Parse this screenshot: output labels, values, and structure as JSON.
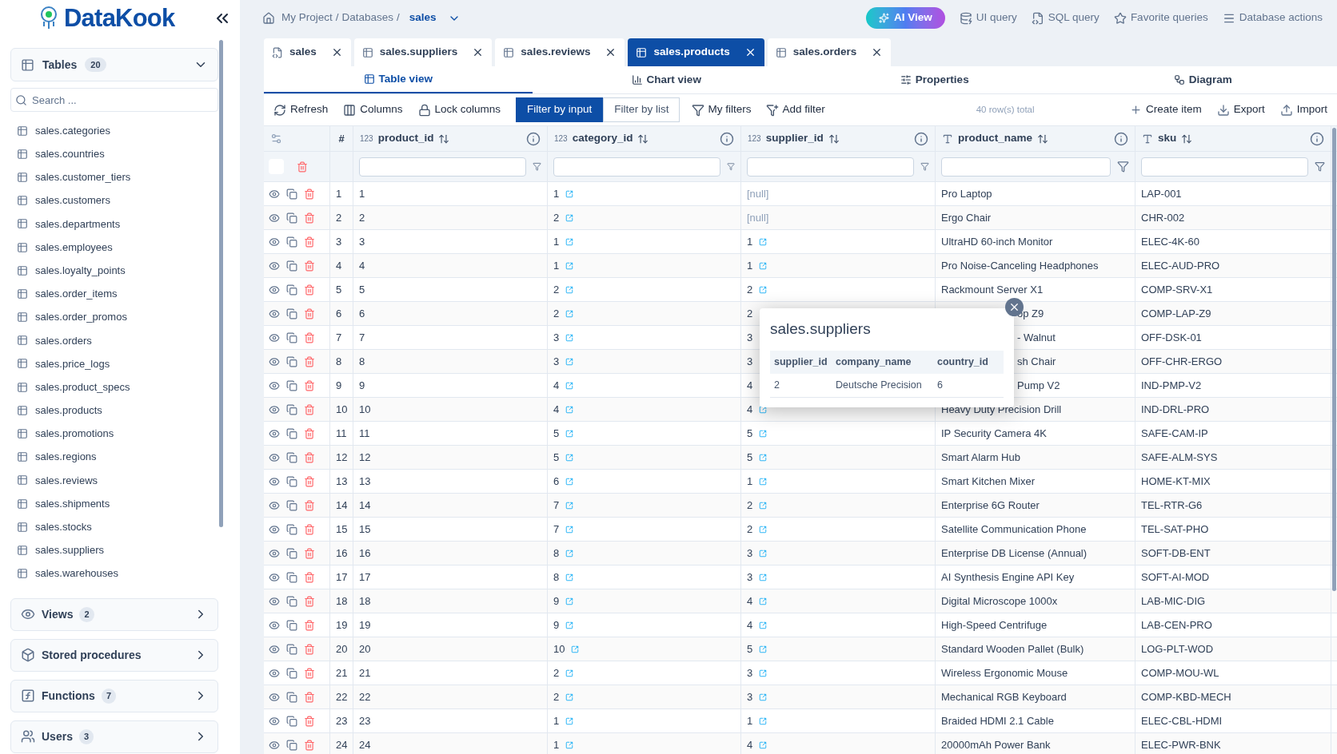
{
  "sidebar": {
    "logo": "DataKook",
    "tables": {
      "label": "Tables",
      "count": "20",
      "expanded": true,
      "search_placeholder": "Search ...",
      "items": [
        "sales.categories",
        "sales.countries",
        "sales.customer_tiers",
        "sales.customers",
        "sales.departments",
        "sales.employees",
        "sales.loyalty_points",
        "sales.order_items",
        "sales.order_promos",
        "sales.orders",
        "sales.price_logs",
        "sales.product_specs",
        "sales.products",
        "sales.promotions",
        "sales.regions",
        "sales.reviews",
        "sales.shipments",
        "sales.stocks",
        "sales.suppliers",
        "sales.warehouses"
      ]
    },
    "sections": [
      {
        "label": "Views",
        "count": "2",
        "kind": "views",
        "expanded": false
      },
      {
        "label": "Stored procedures",
        "kind": "procedures",
        "expanded": false
      },
      {
        "label": "Functions",
        "count": "7",
        "kind": "functions",
        "expanded": false
      },
      {
        "label": "Users",
        "count": "3",
        "kind": "users",
        "expanded": false
      }
    ]
  },
  "breadcrumb": {
    "items": [
      "My Project",
      "Databases"
    ],
    "separator": "/",
    "current": "sales"
  },
  "top_actions": {
    "ai": "AI View",
    "items": [
      {
        "label": "UI query",
        "kind": "ui"
      },
      {
        "label": "SQL query",
        "kind": "sql"
      },
      {
        "label": "Favorite queries",
        "kind": "favorite"
      },
      {
        "label": "Database actions",
        "kind": "menu"
      }
    ]
  },
  "tabs": [
    {
      "label": "sales",
      "kind": "sql",
      "selected": false
    },
    {
      "label": "sales.suppliers",
      "kind": "table",
      "selected": false
    },
    {
      "label": "sales.reviews",
      "kind": "table",
      "selected": false
    },
    {
      "label": "sales.products",
      "kind": "table",
      "selected": true
    },
    {
      "label": "sales.orders",
      "kind": "table",
      "selected": false
    }
  ],
  "view_tabs": [
    {
      "label": "Table view",
      "kind": "table",
      "selected": true
    },
    {
      "label": "Chart view",
      "kind": "chart",
      "selected": false
    },
    {
      "label": "Properties",
      "kind": "properties",
      "selected": false
    },
    {
      "label": "Diagram",
      "kind": "diagram",
      "selected": false
    }
  ],
  "toolbar": {
    "left": [
      {
        "label": "Refresh",
        "kind": "refresh"
      },
      {
        "label": "Columns",
        "kind": "columns"
      },
      {
        "label": "Lock columns",
        "kind": "lock"
      }
    ],
    "filter_modes": [
      {
        "label": "Filter by input",
        "selected": true
      },
      {
        "label": "Filter by list",
        "selected": false
      }
    ],
    "filters": [
      {
        "label": "My filters",
        "kind": "my"
      },
      {
        "label": "Add filter",
        "kind": "add"
      }
    ],
    "row_count": "40 row(s) total",
    "right": [
      {
        "label": "Create item",
        "kind": "create"
      },
      {
        "label": "Export",
        "kind": "export"
      },
      {
        "label": "Import",
        "kind": "import"
      }
    ]
  },
  "table": {
    "number_header": "#",
    "select_all": {
      "checked": false
    },
    "columns": [
      {
        "name": "product_id",
        "kind": "number",
        "type_label": "123"
      },
      {
        "name": "category_id",
        "kind": "number",
        "type_label": "123"
      },
      {
        "name": "supplier_id",
        "kind": "number",
        "type_label": "123"
      },
      {
        "name": "product_name",
        "kind": "text"
      },
      {
        "name": "sku",
        "kind": "text"
      }
    ],
    "rows": [
      {
        "number": "1",
        "cells": [
          "1",
          {
            "text": "1",
            "kind": "link"
          },
          {
            "text": "[null]",
            "kind": "null"
          },
          "Pro Laptop",
          "LAP-001"
        ]
      },
      {
        "number": "2",
        "cells": [
          "2",
          {
            "text": "2",
            "kind": "link"
          },
          {
            "text": "[null]",
            "kind": "null"
          },
          "Ergo Chair",
          "CHR-002"
        ]
      },
      {
        "number": "3",
        "cells": [
          "3",
          {
            "text": "1",
            "kind": "link"
          },
          {
            "text": "1",
            "kind": "link"
          },
          "UltraHD 60-inch Monitor",
          "ELEC-4K-60"
        ]
      },
      {
        "number": "4",
        "cells": [
          "4",
          {
            "text": "1",
            "kind": "link"
          },
          {
            "text": "1",
            "kind": "link"
          },
          "Pro Noise-Canceling Headphones",
          "ELEC-AUD-PRO"
        ]
      },
      {
        "number": "5",
        "cells": [
          "5",
          {
            "text": "2",
            "kind": "link"
          },
          {
            "text": "2",
            "kind": "link"
          },
          "Rackmount Server X1",
          "COMP-SRV-X1"
        ]
      },
      {
        "number": "6",
        "cells": [
          "6",
          {
            "text": "2",
            "kind": "link"
          },
          {
            "text": "2",
            "kind": "covered"
          },
          {
            "text": "op Z9",
            "kind": "partial"
          },
          "COMP-LAP-Z9"
        ]
      },
      {
        "number": "7",
        "cells": [
          "7",
          {
            "text": "3",
            "kind": "link"
          },
          {
            "text": "3",
            "kind": "covered"
          },
          {
            "text": "- Walnut",
            "kind": "partial"
          },
          "OFF-DSK-01"
        ]
      },
      {
        "number": "8",
        "cells": [
          "8",
          {
            "text": "3",
            "kind": "link"
          },
          {
            "text": "3",
            "kind": "covered"
          },
          {
            "text": "sh Chair",
            "kind": "partial"
          },
          "OFF-CHR-ERGO"
        ]
      },
      {
        "number": "9",
        "cells": [
          "9",
          {
            "text": "4",
            "kind": "link"
          },
          {
            "text": "4",
            "kind": "covered"
          },
          {
            "text": "Pump V2",
            "kind": "partial"
          },
          "IND-PMP-V2"
        ]
      },
      {
        "number": "10",
        "cells": [
          "10",
          {
            "text": "4",
            "kind": "link"
          },
          {
            "text": "4",
            "kind": "link"
          },
          "Heavy Duty Precision Drill",
          "IND-DRL-PRO"
        ]
      },
      {
        "number": "11",
        "cells": [
          "11",
          {
            "text": "5",
            "kind": "link"
          },
          {
            "text": "5",
            "kind": "link"
          },
          "IP Security Camera 4K",
          "SAFE-CAM-IP"
        ]
      },
      {
        "number": "12",
        "cells": [
          "12",
          {
            "text": "5",
            "kind": "link"
          },
          {
            "text": "5",
            "kind": "link"
          },
          "Smart Alarm Hub",
          "SAFE-ALM-SYS"
        ]
      },
      {
        "number": "13",
        "cells": [
          "13",
          {
            "text": "6",
            "kind": "link"
          },
          {
            "text": "1",
            "kind": "link"
          },
          "Smart Kitchen Mixer",
          "HOME-KT-MIX"
        ]
      },
      {
        "number": "14",
        "cells": [
          "14",
          {
            "text": "7",
            "kind": "link"
          },
          {
            "text": "2",
            "kind": "link"
          },
          "Enterprise 6G Router",
          "TEL-RTR-G6"
        ]
      },
      {
        "number": "15",
        "cells": [
          "15",
          {
            "text": "7",
            "kind": "link"
          },
          {
            "text": "2",
            "kind": "link"
          },
          "Satellite Communication Phone",
          "TEL-SAT-PHO"
        ]
      },
      {
        "number": "16",
        "cells": [
          "16",
          {
            "text": "8",
            "kind": "link"
          },
          {
            "text": "3",
            "kind": "link"
          },
          "Enterprise DB License (Annual)",
          "SOFT-DB-ENT"
        ]
      },
      {
        "number": "17",
        "cells": [
          "17",
          {
            "text": "8",
            "kind": "link"
          },
          {
            "text": "3",
            "kind": "link"
          },
          "AI Synthesis Engine API Key",
          "SOFT-AI-MOD"
        ]
      },
      {
        "number": "18",
        "cells": [
          "18",
          {
            "text": "9",
            "kind": "link"
          },
          {
            "text": "4",
            "kind": "link"
          },
          "Digital Microscope 1000x",
          "LAB-MIC-DIG"
        ]
      },
      {
        "number": "19",
        "cells": [
          "19",
          {
            "text": "9",
            "kind": "link"
          },
          {
            "text": "4",
            "kind": "link"
          },
          "High-Speed Centrifuge",
          "LAB-CEN-PRO"
        ]
      },
      {
        "number": "20",
        "cells": [
          "20",
          {
            "text": "10",
            "kind": "link"
          },
          {
            "text": "5",
            "kind": "link"
          },
          "Standard Wooden Pallet (Bulk)",
          "LOG-PLT-WOD"
        ]
      },
      {
        "number": "21",
        "cells": [
          "21",
          {
            "text": "2",
            "kind": "link"
          },
          {
            "text": "3",
            "kind": "link"
          },
          "Wireless Ergonomic Mouse",
          "COMP-MOU-WL"
        ]
      },
      {
        "number": "22",
        "cells": [
          "22",
          {
            "text": "2",
            "kind": "link"
          },
          {
            "text": "3",
            "kind": "link"
          },
          "Mechanical RGB Keyboard",
          "COMP-KBD-MECH"
        ]
      },
      {
        "number": "23",
        "cells": [
          "23",
          {
            "text": "1",
            "kind": "link"
          },
          {
            "text": "1",
            "kind": "link"
          },
          "Braided HDMI 2.1 Cable",
          "ELEC-CBL-HDMI"
        ]
      },
      {
        "number": "24",
        "cells": [
          "24",
          {
            "text": "1",
            "kind": "link"
          },
          {
            "text": "4",
            "kind": "link"
          },
          "20000mAh Power Bank",
          "ELEC-PWR-BNK"
        ]
      }
    ]
  },
  "popup": {
    "title": "sales.suppliers",
    "columns": [
      "supplier_id",
      "company_name",
      "country_id"
    ],
    "rows": [
      [
        "2",
        "Deutsche Precision",
        "6"
      ]
    ]
  }
}
